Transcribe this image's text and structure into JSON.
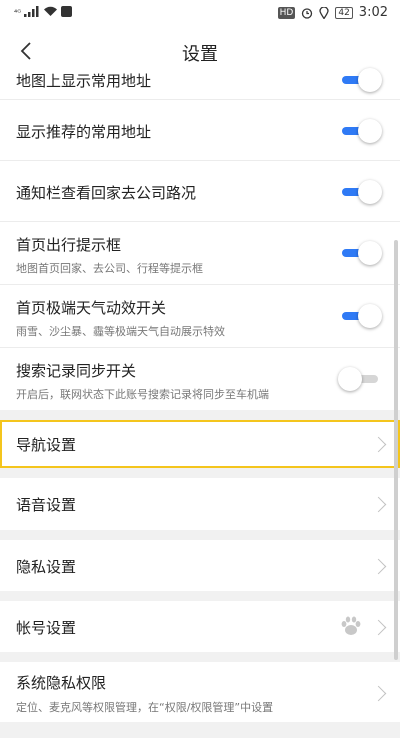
{
  "status_bar": {
    "carrier_marks": "⁴ᴳ",
    "hd": "HD",
    "battery": "42",
    "time": "3:02"
  },
  "navbar": {
    "title": "设置"
  },
  "toggles": [
    {
      "title": "地图上显示常用地址",
      "subtitle": "",
      "on": true
    },
    {
      "title": "显示推荐的常用地址",
      "subtitle": "",
      "on": true
    },
    {
      "title": "通知栏查看回家去公司路况",
      "subtitle": "",
      "on": true
    },
    {
      "title": "首页出行提示框",
      "subtitle": "地图首页回家、去公司、行程等提示框",
      "on": true
    },
    {
      "title": "首页极端天气动效开关",
      "subtitle": "雨雪、沙尘暴、霾等极端天气自动展示特效",
      "on": true
    },
    {
      "title": "搜索记录同步开关",
      "subtitle": "开启后，联网状态下此账号搜索记录将同步至车机端",
      "on": false
    }
  ],
  "menu": {
    "navigation": "导航设置",
    "voice": "语音设置",
    "privacy": "隐私设置",
    "account": "帐号设置",
    "system_privacy": "系统隐私权限",
    "system_privacy_sub": "定位、麦克风等权限管理，在“权限/权限管理”中设置"
  },
  "icons": {
    "back": "back-arrow-icon",
    "chevron": "chevron-right-icon",
    "account_logo": "baidu-paw-icon"
  },
  "colors": {
    "toggle_on": "#2f7af5",
    "highlight": "#f4c51d",
    "section_gap": "#f1f1f1"
  }
}
